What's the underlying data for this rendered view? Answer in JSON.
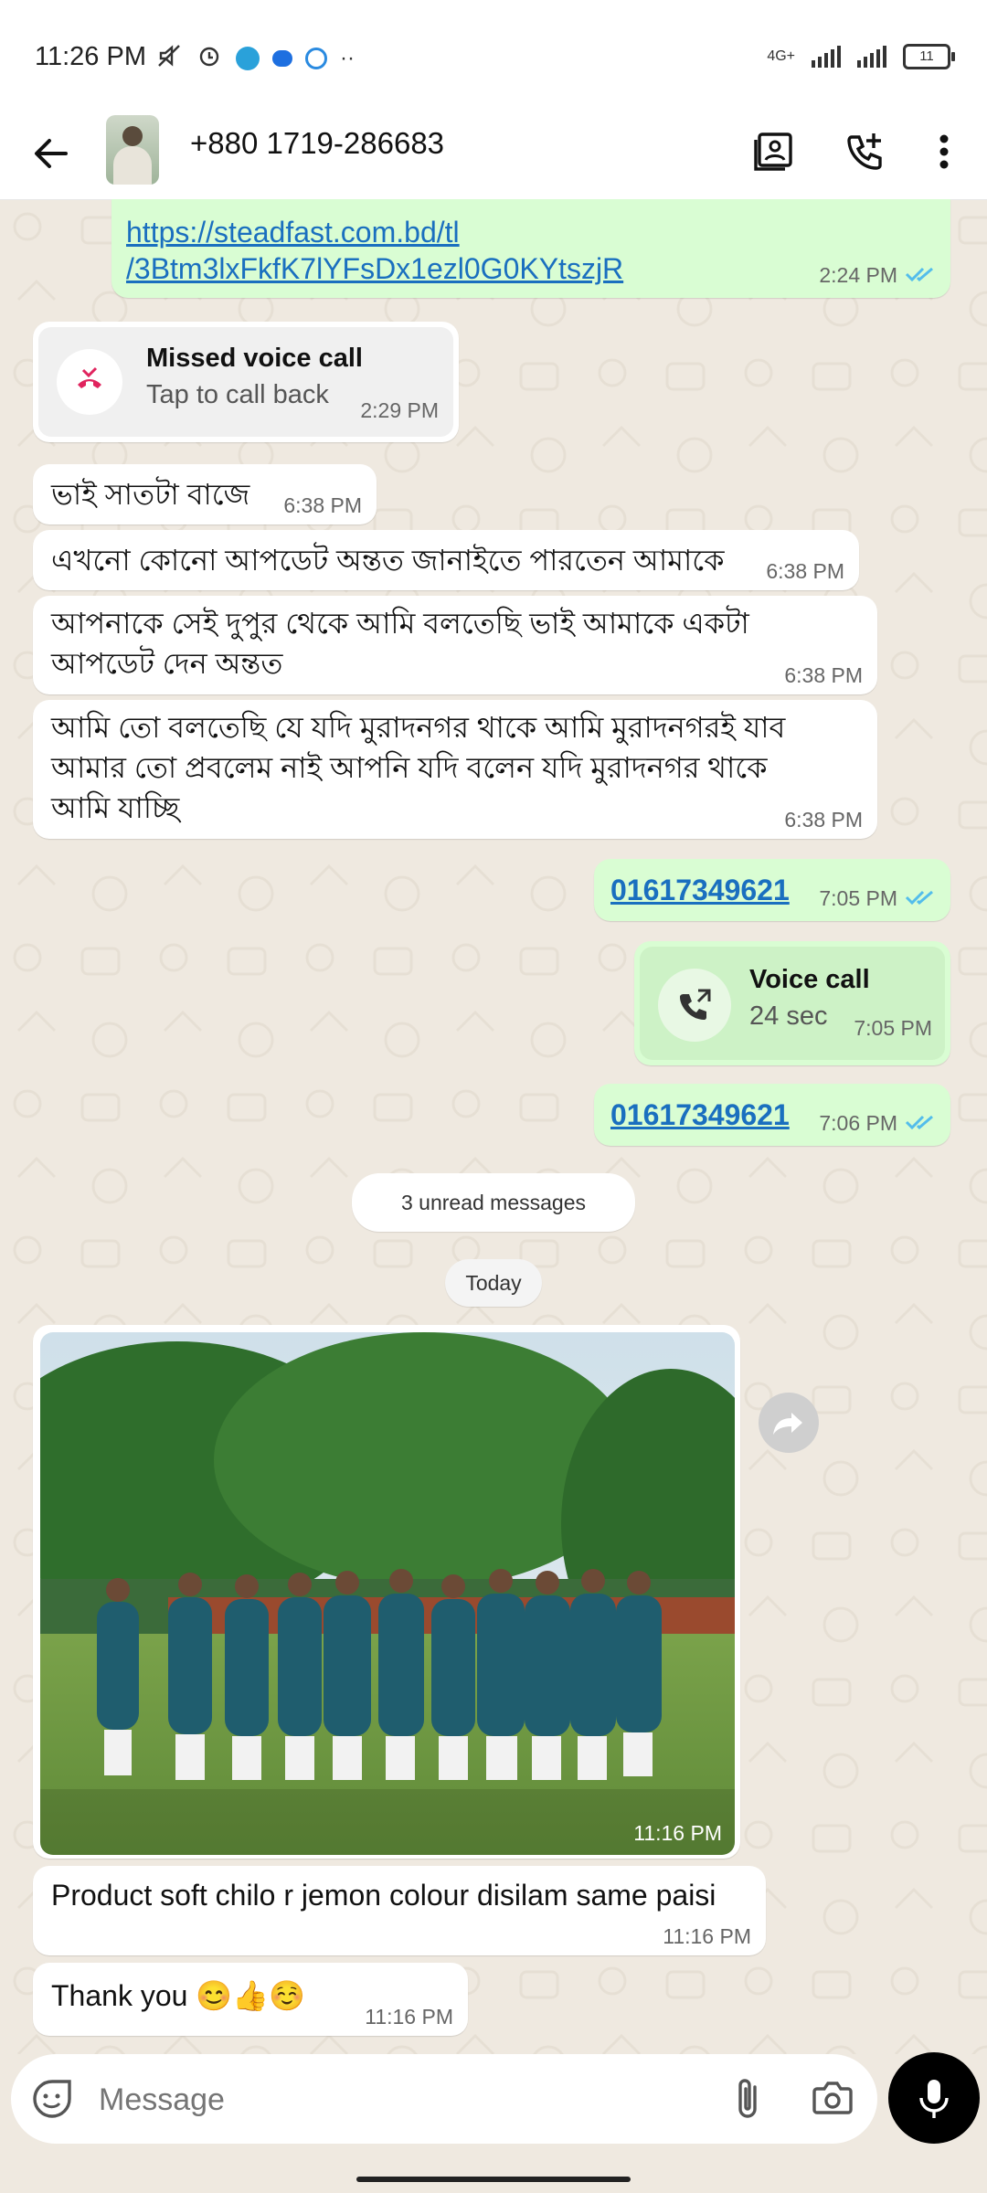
{
  "status_bar": {
    "time": "11:26 PM",
    "network_label": "4G+",
    "battery_level": "11"
  },
  "header": {
    "contact_name": "+880 1719-286683"
  },
  "messages": {
    "link": {
      "line1": "https://steadfast.com.bd/tl",
      "line2": "/3Btm3lxFkfK7lYFsDx1ezl0G0KYtszjR",
      "time": "2:24 PM"
    },
    "missed_call": {
      "title": "Missed voice call",
      "subtitle": "Tap to call back",
      "time": "2:29 PM"
    },
    "m1": {
      "text": "ভাই সাতটা বাজে",
      "time": "6:38 PM"
    },
    "m2": {
      "text": "এখনো কোনো আপডেট অন্তত জানাইতে পারতেন আমাকে",
      "time": "6:38 PM"
    },
    "m3": {
      "line1": "আপনাকে সেই দুপুর থেকে আমি বলতেছি ভাই আমাকে একটা",
      "line2": "আপডেট দেন অন্তত",
      "time": "6:38 PM"
    },
    "m4": {
      "line1": "আমি তো বলতেছি যে যদি মুরাদনগর থাকে আমি মুরাদনগরই যাব",
      "line2": "আমার তো প্রবলেম নাই আপনি যদি বলেন যদি মুরাদনগর থাকে",
      "line3": "আমি যাচ্ছি",
      "time": "6:38 PM"
    },
    "phone1": {
      "text": "01617349621",
      "time": "7:05 PM"
    },
    "voice_call": {
      "title": "Voice call",
      "duration": "24 sec",
      "time": "7:05 PM"
    },
    "phone2": {
      "text": "01617349621",
      "time": "7:06 PM"
    },
    "unread": "3 unread messages",
    "date": "Today",
    "photo": {
      "time": "11:16 PM"
    },
    "m5": {
      "text": "Product soft chilo r jemon colour disilam same paisi",
      "time": "11:16 PM"
    },
    "m6": {
      "text": "Thank you 😊👍☺️",
      "time": "11:16 PM"
    }
  },
  "input": {
    "placeholder": "Message"
  },
  "colors": {
    "outgoing": "#d9fdd3",
    "incoming": "#ffffff",
    "link": "#1a6fbf",
    "ticks": "#53bdeb",
    "missed": "#e0245e"
  }
}
